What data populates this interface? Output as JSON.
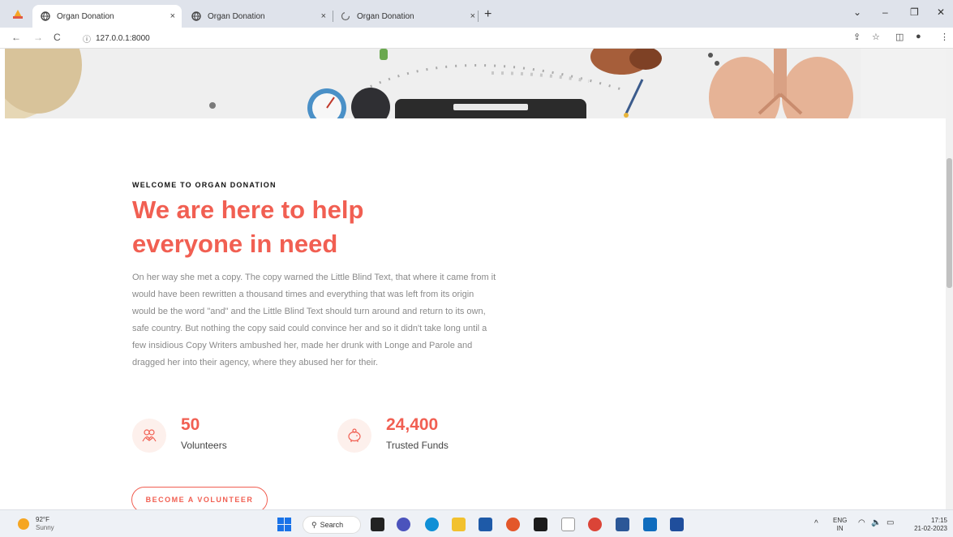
{
  "browser": {
    "tabs": [
      {
        "title": "Organ Donation",
        "close": "×"
      },
      {
        "title": "Organ Donation",
        "close": "×"
      },
      {
        "title": "Organ Donation",
        "close": "×"
      }
    ],
    "new_tab": "+",
    "url": "127.0.0.1:8000",
    "window_controls": {
      "minimize": "–",
      "restore": "❐",
      "close": "✕"
    }
  },
  "page": {
    "kicker": "WELCOME TO ORGAN DONATION",
    "headline_line1": "We are here to help",
    "headline_line2": "everyone in need",
    "paragraph": "On her way she met a copy. The copy warned the Little Blind Text, that where it came from it would have been rewritten a thousand times and everything that was left from its origin would be the word \"and\" and the Little Blind Text should turn around and return to its own, safe country. But nothing the copy said could convince her and so it didn't take long until a few insidious Copy Writers ambushed her, made her drunk with Longe and Parole and dragged her into their agency, where they abused her for their.",
    "stats": [
      {
        "value": "50",
        "label": "Volunteers",
        "icon": "volunteers-icon"
      },
      {
        "value": "24,400",
        "label": "Trusted Funds",
        "icon": "piggy-bank-icon"
      }
    ],
    "cta_label": "BECOME A VOLUNTEER",
    "accent_color": "#f15f52"
  },
  "taskbar": {
    "weather_temp": "92°F",
    "weather_desc": "Sunny",
    "search_label": "Search",
    "lang_top": "ENG",
    "lang_bottom": "IN",
    "time": "17:15",
    "date": "21-02-2023"
  }
}
